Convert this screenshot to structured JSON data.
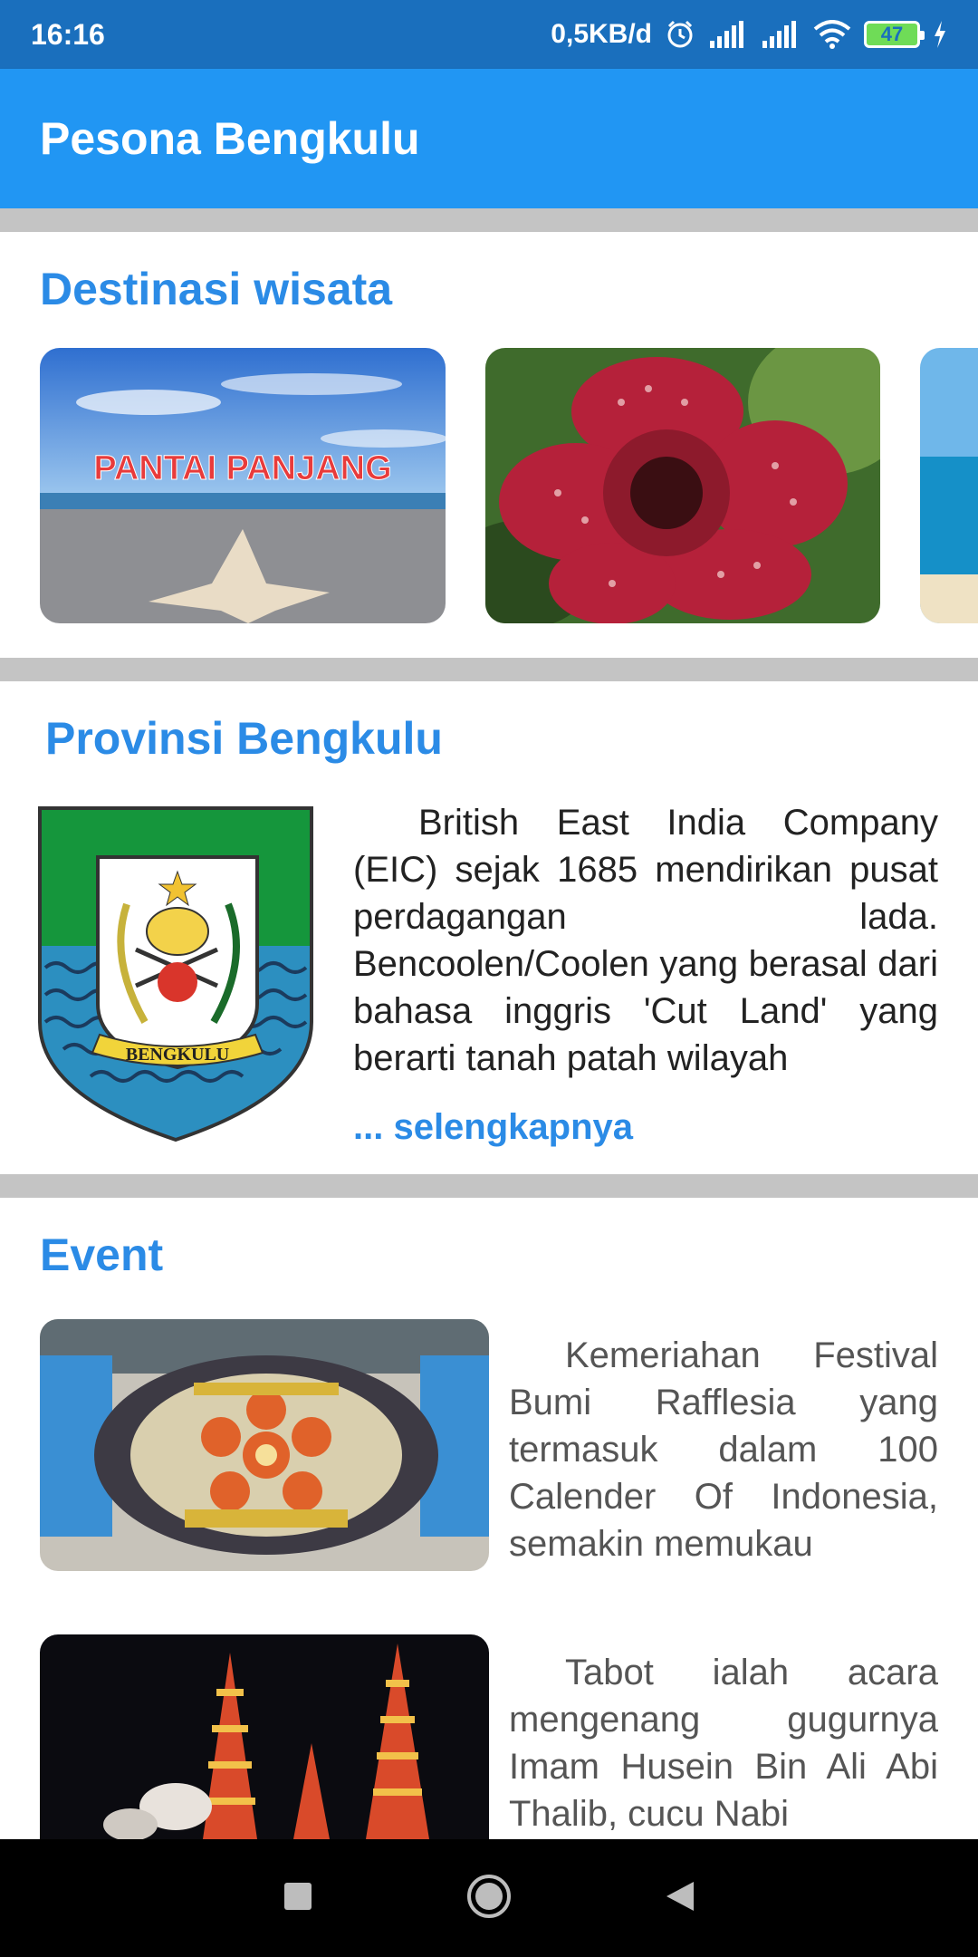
{
  "status_bar": {
    "time": "16:16",
    "net_speed": "0,5KB/d",
    "battery": "47"
  },
  "app_bar": {
    "title": "Pesona Bengkulu"
  },
  "destinasi": {
    "title": "Destinasi wisata",
    "cards": [
      {
        "sign_text": "PANTAI PANJANG"
      },
      {
        "name": ""
      },
      {
        "name": ""
      }
    ]
  },
  "provinsi": {
    "title": "Provinsi Bengkulu",
    "emblem_text": "BENGKULU",
    "description": "British East India Company (EIC) sejak 1685 mendirikan pusat perdagangan lada. Bencoolen/Coolen yang berasal dari bahasa inggris 'Cut Land' yang berarti tanah patah wilayah",
    "more_label": "... selengkapnya"
  },
  "event": {
    "title": "Event",
    "items": [
      {
        "text": "Kemeriahan Festival Bumi Rafflesia yang termasuk dalam 100 Calender Of Indonesia, semakin memukau"
      },
      {
        "text": "Tabot ialah acara mengenang gugurnya Imam Husein Bin Ali Abi Thalib, cucu Nabi"
      }
    ]
  },
  "colors": {
    "status_bar": "#1a6fbd",
    "app_bar": "#2196f3",
    "section_title": "#2b8be6",
    "divider": "#c4c4c4"
  },
  "nav": {
    "icons": [
      "square-icon",
      "circle-home-icon",
      "triangle-back-icon"
    ]
  }
}
